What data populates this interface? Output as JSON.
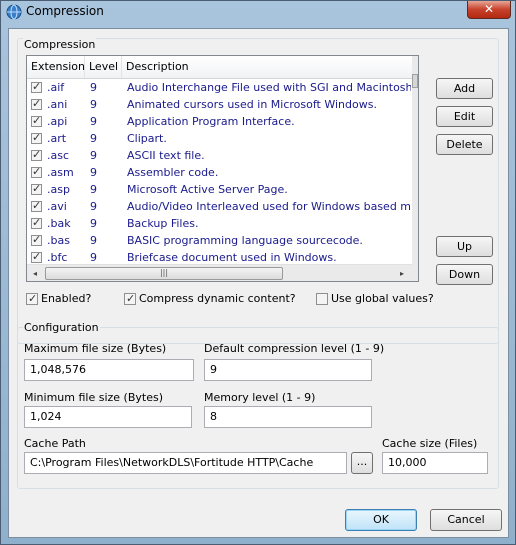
{
  "window": {
    "title": "Compression",
    "close_glyph": "✕",
    "app_icon": "globe-icon"
  },
  "compression_group": {
    "label": "Compression",
    "columns": [
      "Extension",
      "Level",
      "Description"
    ],
    "rows": [
      {
        "checked": true,
        "ext": ".aif",
        "level": "9",
        "desc": "Audio Interchange File used with SGI and Macintosh applications."
      },
      {
        "checked": true,
        "ext": ".ani",
        "level": "9",
        "desc": "Animated cursors used in Microsoft Windows."
      },
      {
        "checked": true,
        "ext": ".api",
        "level": "9",
        "desc": "Application Program Interface."
      },
      {
        "checked": true,
        "ext": ".art",
        "level": "9",
        "desc": "Clipart."
      },
      {
        "checked": true,
        "ext": ".asc",
        "level": "9",
        "desc": "ASCII text file."
      },
      {
        "checked": true,
        "ext": ".asm",
        "level": "9",
        "desc": "Assembler code."
      },
      {
        "checked": true,
        "ext": ".asp",
        "level": "9",
        "desc": "Microsoft Active Server Page."
      },
      {
        "checked": true,
        "ext": ".avi",
        "level": "9",
        "desc": "Audio/Video Interleaved used for Windows based movies."
      },
      {
        "checked": true,
        "ext": ".bak",
        "level": "9",
        "desc": "Backup Files."
      },
      {
        "checked": true,
        "ext": ".bas",
        "level": "9",
        "desc": "BASIC programming language sourcecode."
      },
      {
        "checked": true,
        "ext": ".bfc",
        "level": "9",
        "desc": "Briefcase document used in Windows."
      }
    ],
    "buttons": {
      "add": "Add",
      "edit": "Edit",
      "delete": "Delete",
      "up": "Up",
      "down": "Down"
    },
    "scroll_left": "◂",
    "scroll_right": "▸",
    "thumb_grip": "|||",
    "options": {
      "enabled": {
        "label": "Enabled?",
        "checked": true
      },
      "dynamic": {
        "label": "Compress dynamic content?",
        "checked": true
      },
      "global": {
        "label": "Use global values?",
        "checked": false
      }
    }
  },
  "configuration_group": {
    "label": "Configuration",
    "max_file_size": {
      "label": "Maximum file size (Bytes)",
      "value": "1,048,576"
    },
    "default_level": {
      "label": "Default compression level (1 - 9)",
      "value": "9"
    },
    "min_file_size": {
      "label": "Minimum file size (Bytes)",
      "value": "1,024"
    },
    "memory_level": {
      "label": "Memory level (1 - 9)",
      "value": "8"
    },
    "cache_path": {
      "label": "Cache Path",
      "value": "C:\\Program Files\\NetworkDLS\\Fortitude HTTP\\Cache",
      "browse": "..."
    },
    "cache_size": {
      "label": "Cache size (Files)",
      "value": "10,000"
    }
  },
  "footer": {
    "ok": "OK",
    "cancel": "Cancel"
  }
}
